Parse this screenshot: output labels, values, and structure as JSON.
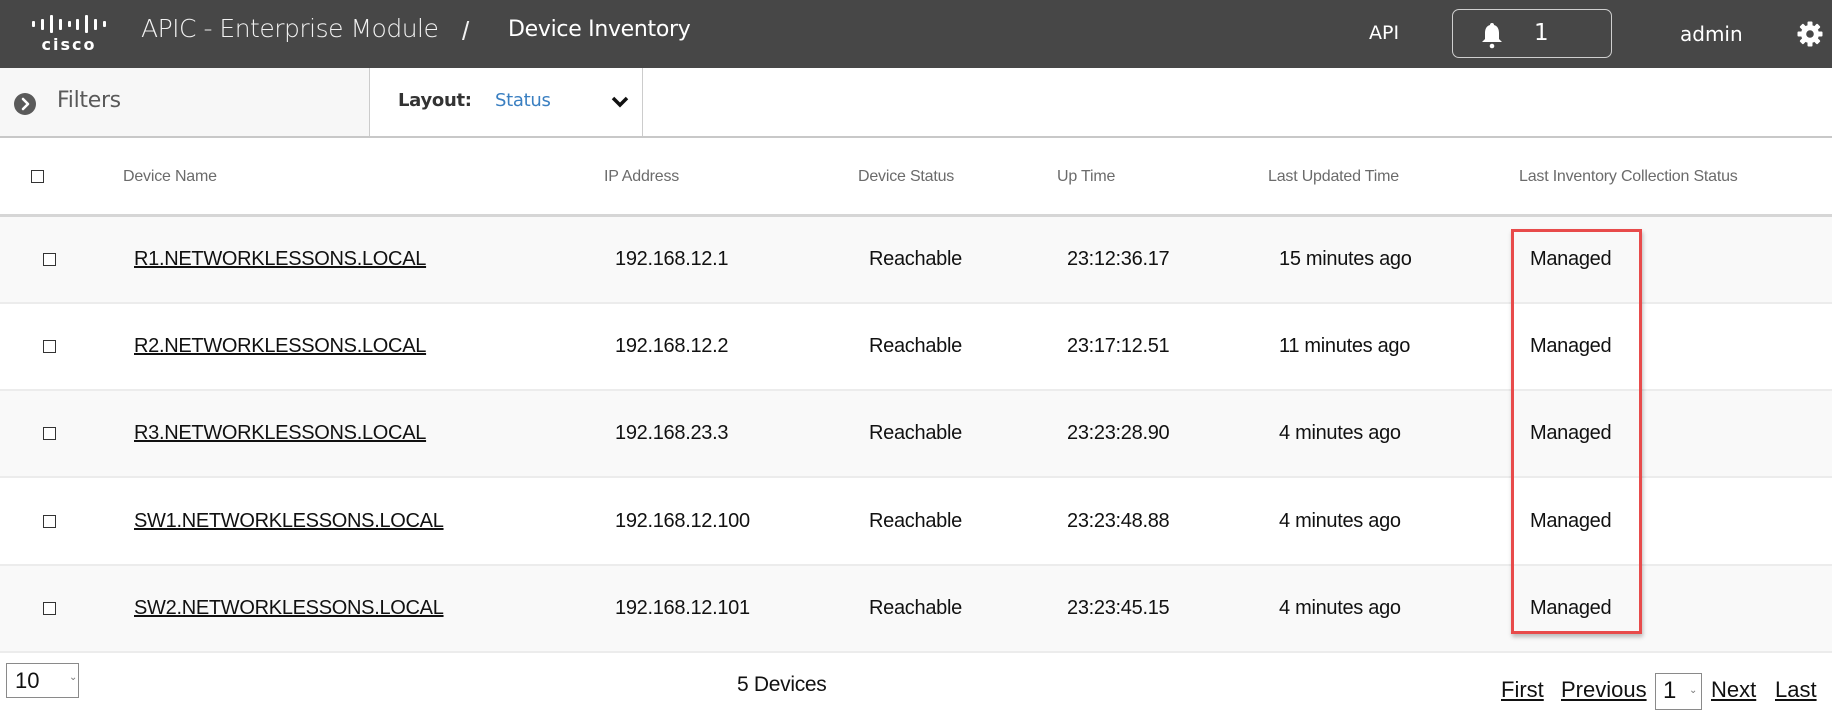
{
  "header": {
    "logo_text": "cisco",
    "app_title": "APIC - Enterprise Module",
    "separator": "/",
    "page_title": "Device Inventory",
    "api_label": "API",
    "notification_count": "1",
    "user": "admin",
    "icons": {
      "bell": "bell-icon",
      "gear": "gear-icon"
    }
  },
  "filterbar": {
    "filters_label": "Filters",
    "layout_label": "Layout:",
    "layout_value": "Status"
  },
  "table": {
    "columns": [
      "Device Name",
      "IP Address",
      "Device Status",
      "Up Time",
      "Last Updated Time",
      "Last Inventory Collection Status"
    ],
    "rows": [
      {
        "name": "R1.NETWORKLESSONS.LOCAL",
        "ip": "192.168.12.1",
        "status": "Reachable",
        "uptime": "23:12:36.17",
        "updated": "15 minutes ago",
        "collection": "Managed"
      },
      {
        "name": "R2.NETWORKLESSONS.LOCAL",
        "ip": "192.168.12.2",
        "status": "Reachable",
        "uptime": "23:17:12.51",
        "updated": "11 minutes ago",
        "collection": "Managed"
      },
      {
        "name": "R3.NETWORKLESSONS.LOCAL",
        "ip": "192.168.23.3",
        "status": "Reachable",
        "uptime": "23:23:28.90",
        "updated": "4 minutes ago",
        "collection": "Managed"
      },
      {
        "name": "SW1.NETWORKLESSONS.LOCAL",
        "ip": "192.168.12.100",
        "status": "Reachable",
        "uptime": "23:23:48.88",
        "updated": "4 minutes ago",
        "collection": "Managed"
      },
      {
        "name": "SW2.NETWORKLESSONS.LOCAL",
        "ip": "192.168.12.101",
        "status": "Reachable",
        "uptime": "23:23:45.15",
        "updated": "4 minutes ago",
        "collection": "Managed"
      }
    ],
    "highlight_color": "#e84b4b"
  },
  "footer": {
    "page_size": "10",
    "device_count": "5 Devices",
    "first": "First",
    "previous": "Previous",
    "current_page": "1",
    "next": "Next",
    "last": "Last"
  },
  "colors": {
    "header_bg": "#474747",
    "link_blue": "#3a7fc1",
    "row_alt": "#f9f9f9"
  }
}
